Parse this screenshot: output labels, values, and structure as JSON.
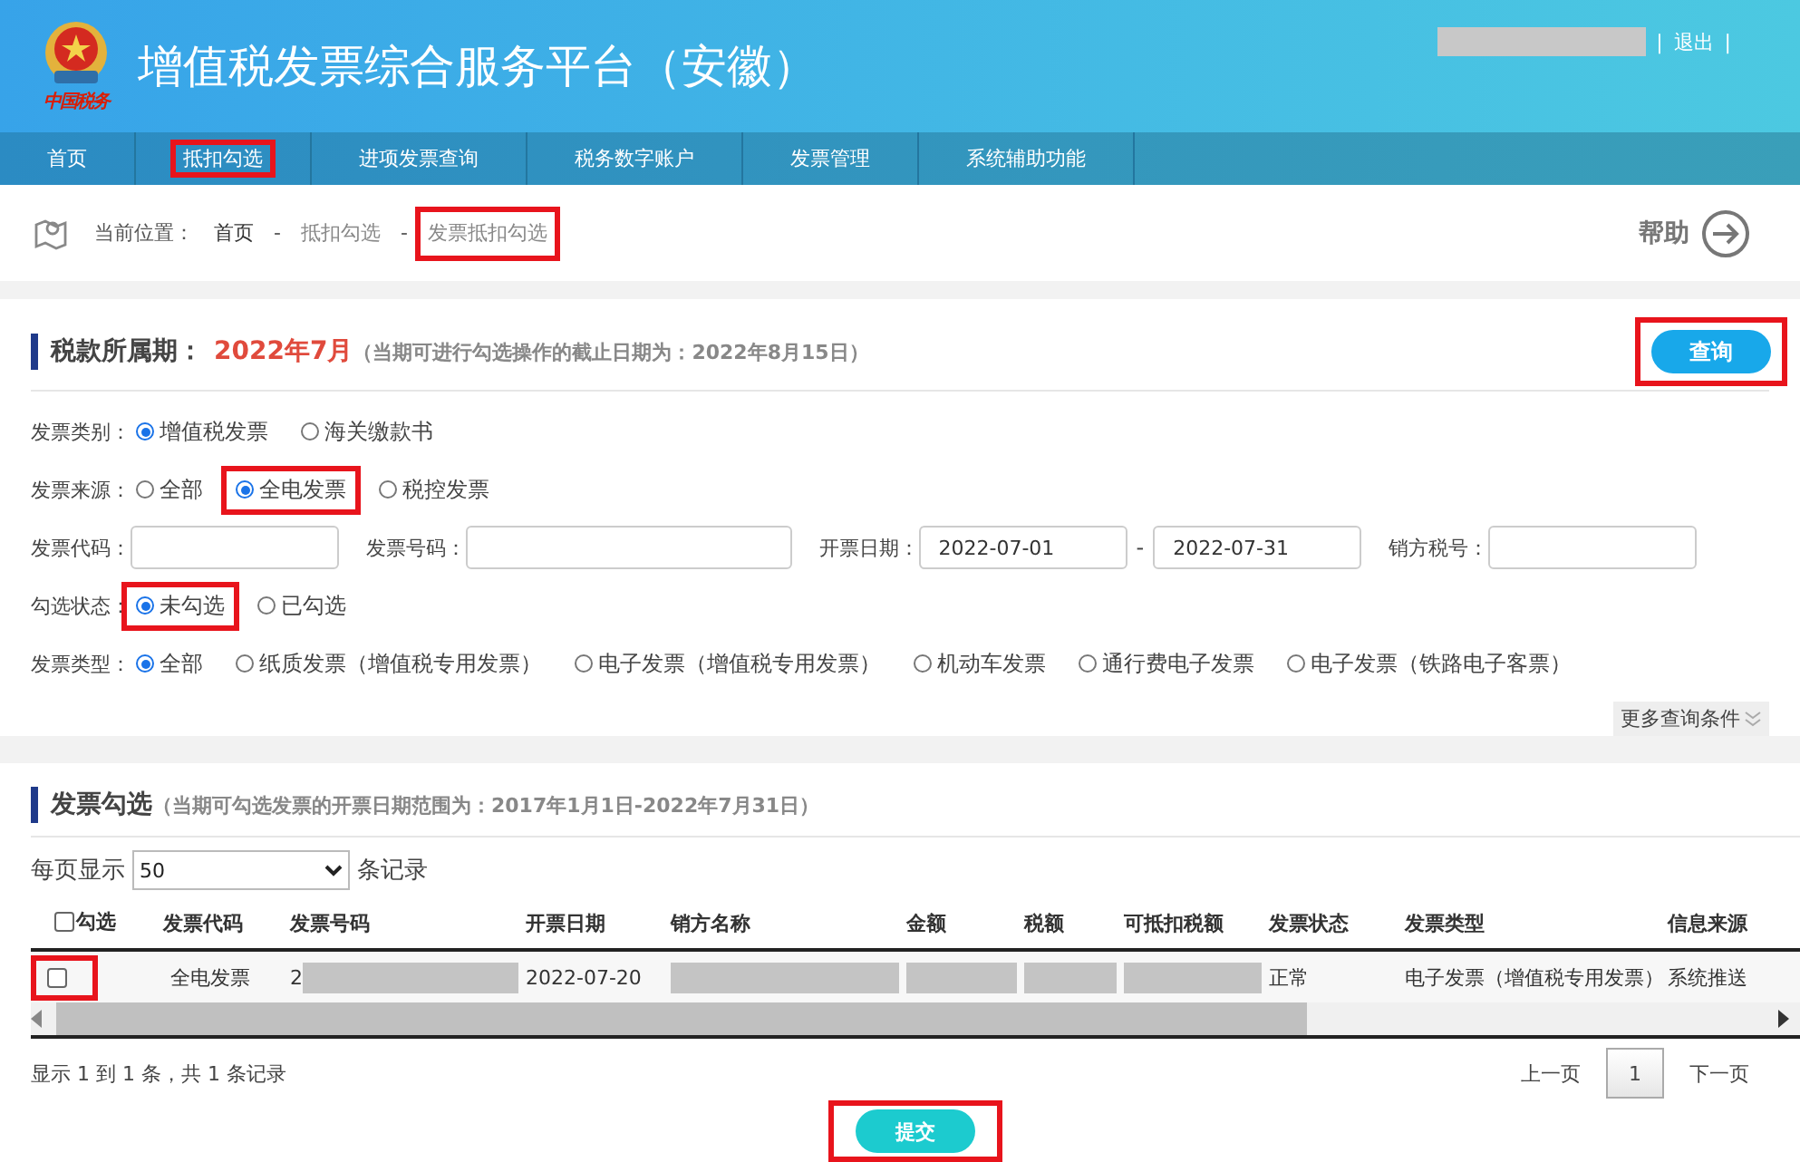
{
  "header": {
    "logo_text": "中国税务",
    "title": "增值税发票综合服务平台（安徽）",
    "separator": "|",
    "logout": "退出"
  },
  "nav": [
    {
      "label": "首页",
      "highlighted": false
    },
    {
      "label": "抵扣勾选",
      "highlighted": true
    },
    {
      "label": "进项发票查询",
      "highlighted": false
    },
    {
      "label": "税务数字账户",
      "highlighted": false
    },
    {
      "label": "发票管理",
      "highlighted": false
    },
    {
      "label": "系统辅助功能",
      "highlighted": false
    }
  ],
  "breadcrumb": {
    "prefix": "当前位置：",
    "items": [
      {
        "label": "首页",
        "highlighted": false
      },
      {
        "label": "抵扣勾选",
        "highlighted": false
      },
      {
        "label": "发票抵扣勾选",
        "highlighted": true
      }
    ],
    "separator": "-",
    "help": "帮助"
  },
  "query": {
    "title": "税款所属期：",
    "period": "2022年7月",
    "note": "（当期可进行勾选操作的截止日期为：2022年8月15日）",
    "button": {
      "label": "查询",
      "highlighted": true
    },
    "filters": [
      {
        "kind": "radio",
        "label": "发票类别：",
        "options": [
          {
            "label": "增值税发票",
            "selected": true,
            "highlighted": false
          },
          {
            "label": "海关缴款书",
            "selected": false,
            "highlighted": false
          }
        ]
      },
      {
        "kind": "radio",
        "label": "发票来源：",
        "options": [
          {
            "label": "全部",
            "selected": false,
            "highlighted": false
          },
          {
            "label": "全电发票",
            "selected": true,
            "highlighted": true
          },
          {
            "label": "税控发票",
            "selected": false,
            "highlighted": false
          }
        ]
      },
      {
        "kind": "fields",
        "items": [
          {
            "label": "发票代码："
          },
          {
            "label": "发票号码："
          },
          {
            "label": "开票日期：",
            "value": "2022-07-01",
            "range_separator": "-",
            "value_to": "2022-07-31"
          },
          {
            "label": "销方税号："
          }
        ]
      },
      {
        "kind": "radio",
        "label": "勾选状态：",
        "options": [
          {
            "label": "未勾选",
            "selected": true,
            "highlighted": true
          },
          {
            "label": "已勾选",
            "selected": false,
            "highlighted": false
          }
        ]
      },
      {
        "kind": "radio",
        "label": "发票类型：",
        "options": [
          {
            "label": "全部",
            "selected": true,
            "highlighted": false
          },
          {
            "label": "纸质发票（增值税专用发票）",
            "selected": false,
            "highlighted": false
          },
          {
            "label": "电子发票（增值税专用发票）",
            "selected": false,
            "highlighted": false
          },
          {
            "label": "机动车发票",
            "selected": false,
            "highlighted": false
          },
          {
            "label": "通行费电子发票",
            "selected": false,
            "highlighted": false
          },
          {
            "label": "电子发票（铁路电子客票）",
            "selected": false,
            "highlighted": false
          }
        ]
      }
    ],
    "more": "更多查询条件"
  },
  "invoices": {
    "title": "发票勾选",
    "note": "（当期可勾选发票的开票日期范围为：2017年1月1日-2022年7月31日）",
    "page_size_label": "每页显示",
    "page_size": "50",
    "page_size_suffix": "条记录",
    "select_all": {
      "checked": false
    },
    "columns": [
      "勾选",
      "发票代码",
      "发票号码",
      "开票日期",
      "销方名称",
      "金额",
      "税额",
      "可抵扣税额",
      "发票状态",
      "发票类型",
      "信息来源"
    ],
    "rows": [
      {
        "cells": [
          {
            "kind": "checkbox",
            "checked": false,
            "highlighted": true
          },
          {
            "kind": "text",
            "text": "全电发票"
          },
          {
            "kind": "redacted",
            "text": "2"
          },
          {
            "kind": "text",
            "text": "2022-07-20"
          },
          {
            "kind": "redacted"
          },
          {
            "kind": "redacted"
          },
          {
            "kind": "redacted"
          },
          {
            "kind": "redacted"
          },
          {
            "kind": "text",
            "text": "正常"
          },
          {
            "kind": "text",
            "text": "电子发票（增值税专用发票）"
          },
          {
            "kind": "text",
            "text": "系统推送"
          }
        ]
      }
    ],
    "summary": "显示 1 到 1 条，共 1 条记录",
    "pager": {
      "prev": "上一页",
      "pages": [
        {
          "label": "1",
          "selected": true
        }
      ],
      "next": "下一页"
    },
    "submit": {
      "label": "提交",
      "highlighted": true
    }
  }
}
